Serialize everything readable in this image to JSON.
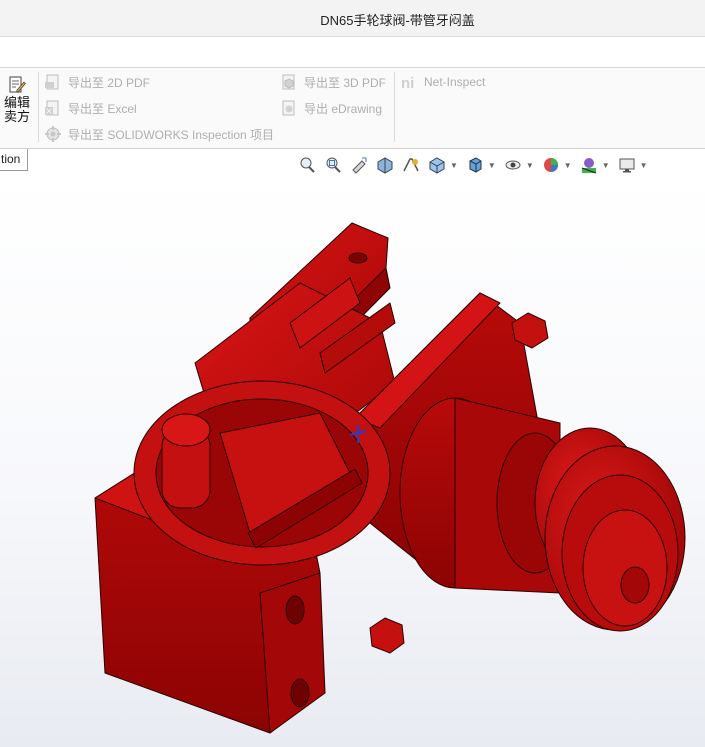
{
  "window": {
    "title": "DN65手轮球阀-带管牙闷盖"
  },
  "ribbon": {
    "edit_label": "编辑卖方",
    "export_2d_pdf": "导出至 2D PDF",
    "export_excel": "导出至 Excel",
    "export_inspection": "导出至 SOLIDWORKS Inspection 项目",
    "export_3d_pdf": "导出至 3D PDF",
    "export_edrawing": "导出 eDrawing",
    "net_inspect": "Net-Inspect"
  },
  "tabs": {
    "active_tab_fragment": "tion"
  },
  "heads_up_toolbar": {
    "icons": [
      "zoom-to-fit-icon",
      "zoom-to-area-icon",
      "previous-view-icon",
      "section-view-icon",
      "dynamic-annotation-icon",
      "view-orientation-icon",
      "display-style-icon",
      "hide-show-items-icon",
      "edit-appearance-icon",
      "apply-scene-icon",
      "view-settings-icon"
    ]
  },
  "model": {
    "color": "#c41010",
    "name": "DN65 handwheel ball valve with threaded cap"
  }
}
